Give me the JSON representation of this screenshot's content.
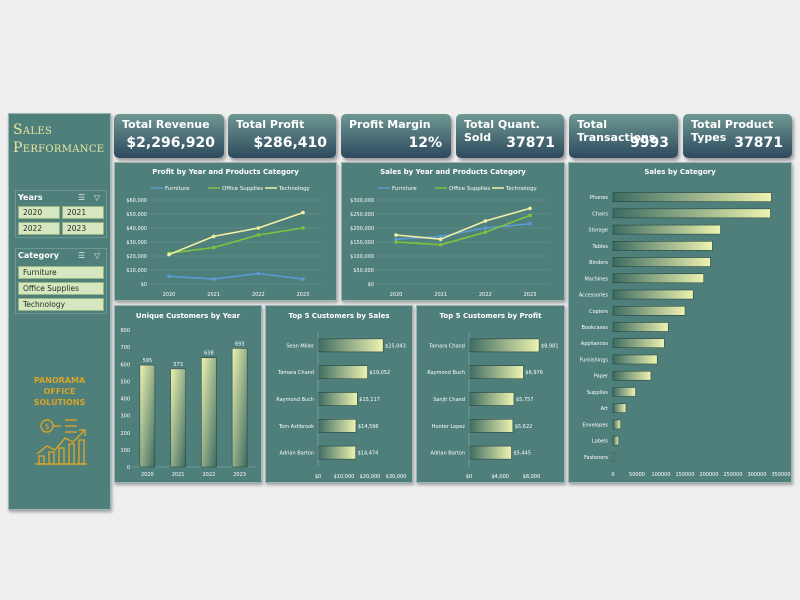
{
  "sidebar": {
    "title_line1": "Sales",
    "title_line2": "Performance",
    "years_label": "Years",
    "years": [
      "2020",
      "2021",
      "2022",
      "2023"
    ],
    "category_label": "Category",
    "categories": [
      "Furniture",
      "Office Supplies",
      "Technology"
    ],
    "logo_line1": "PANORAMA",
    "logo_line2": "OFFICE",
    "logo_line3": "SOLUTIONS",
    "logo_icon": "chart-dollar-icon"
  },
  "kpis": [
    {
      "label": "Total Revenue",
      "value": "$2,296,920"
    },
    {
      "label": "Total Profit",
      "value": "$286,410"
    },
    {
      "label": "Profit Margin",
      "value": "12%"
    },
    {
      "label": "Total Quant. Sold",
      "value": "37871"
    },
    {
      "label": "Total Transactions",
      "value": "9993"
    },
    {
      "label": "Total Product Types",
      "value": "37871"
    }
  ],
  "colors": {
    "furniture": "#5b9bd5",
    "office_supplies": "#7ec33f",
    "technology": "#f1f0a4",
    "bar_light": "#eef3b0",
    "bar_dark": "#3d6b62"
  },
  "chart_data": [
    {
      "type": "line",
      "title": "Profit by Year and Products Category",
      "x": [
        "2020",
        "2021",
        "2022",
        "2023"
      ],
      "yticks": [
        "$0",
        "$10,000",
        "$20,000",
        "$30,000",
        "$40,000",
        "$50,000",
        "$60,000"
      ],
      "ylim": [
        0,
        60000
      ],
      "series": [
        {
          "name": "Furniture",
          "values": [
            5500,
            3500,
            7500,
            3500
          ]
        },
        {
          "name": "Office Supplies",
          "values": [
            22000,
            26000,
            35000,
            40000
          ]
        },
        {
          "name": "Technology",
          "values": [
            21000,
            34000,
            40000,
            51000
          ]
        }
      ]
    },
    {
      "type": "line",
      "title": "Sales by Year and Products Category",
      "x": [
        "2020",
        "2021",
        "2022",
        "2023"
      ],
      "yticks": [
        "$0",
        "$50,000",
        "$100,000",
        "$150,000",
        "$200,000",
        "$250,000",
        "$300,000"
      ],
      "ylim": [
        0,
        300000
      ],
      "series": [
        {
          "name": "Furniture",
          "values": [
            160000,
            170000,
            200000,
            215000
          ]
        },
        {
          "name": "Office Supplies",
          "values": [
            150000,
            140000,
            185000,
            245000
          ]
        },
        {
          "name": "Technology",
          "values": [
            175000,
            160000,
            225000,
            270000
          ]
        }
      ]
    },
    {
      "type": "bar",
      "title": "Unique Customers by Year",
      "categories": [
        "2020",
        "2021",
        "2022",
        "2023"
      ],
      "values": [
        595,
        573,
        638,
        693
      ],
      "yticks": [
        "0",
        "100",
        "200",
        "300",
        "400",
        "500",
        "600",
        "700",
        "800"
      ],
      "ylim": [
        0,
        800
      ]
    },
    {
      "type": "bar",
      "title": "Top 5 Customers by Sales",
      "categories": [
        "Sean Miller",
        "Tamara Chand",
        "Raymond Buch",
        "Tom Ashbrook",
        "Adrian Barton"
      ],
      "values": [
        25043,
        19052,
        15117,
        14596,
        14474
      ],
      "labels": [
        "$25,043",
        "$19,052",
        "$15,117",
        "$14,596",
        "$14,474"
      ],
      "xticks": [
        "$0",
        "$10,000",
        "$20,000",
        "$30,000"
      ],
      "xlim": [
        0,
        30000
      ]
    },
    {
      "type": "bar",
      "title": "Top 5 Customers by Profit",
      "categories": [
        "Tamara Chand",
        "Raymond Buch",
        "Sanjit Chand",
        "Hunter Lopez",
        "Adrian Barton"
      ],
      "values": [
        8981,
        6976,
        5757,
        5622,
        5445
      ],
      "labels": [
        "$8,981",
        "$6,976",
        "$5,757",
        "$5,622",
        "$5,445"
      ],
      "xticks": [
        "$0",
        "$4,000",
        "$8,000"
      ],
      "xlim": [
        0,
        10000
      ]
    },
    {
      "type": "bar",
      "title": "Sales by Category",
      "categories": [
        "Phones",
        "Chairs",
        "Storage",
        "Tables",
        "Binders",
        "Machines",
        "Accessories",
        "Copiers",
        "Bookcases",
        "Appliances",
        "Furnishings",
        "Paper",
        "Supplies",
        "Art",
        "Envelopes",
        "Labels",
        "Fasteners"
      ],
      "values": [
        330000,
        328000,
        224000,
        207000,
        203000,
        189000,
        167000,
        150000,
        115000,
        107000,
        92000,
        79000,
        47000,
        27000,
        16000,
        12000,
        3000
      ],
      "xticks": [
        "0",
        "50000",
        "100000",
        "150000",
        "200000",
        "250000",
        "300000",
        "350000"
      ],
      "xlim": [
        0,
        350000
      ]
    }
  ]
}
